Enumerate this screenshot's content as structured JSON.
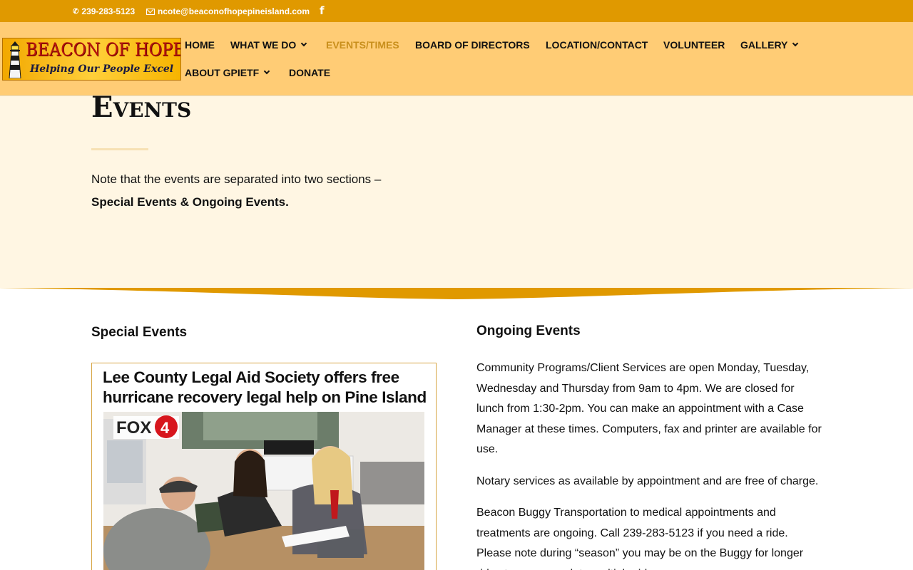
{
  "topbar": {
    "phone": "239-283-5123",
    "email": "ncote@beaconofhopepineisland.com",
    "facebook_icon": "facebook-icon"
  },
  "logo": {
    "line1": "BEACON OF HOPE",
    "line2": "Helping Our People Excel"
  },
  "nav": {
    "items": [
      {
        "label": "HOME"
      },
      {
        "label": "WHAT WE DO"
      },
      {
        "label": "EVENTS/TIMES"
      },
      {
        "label": "BOARD OF DIRECTORS"
      },
      {
        "label": "LOCATION/CONTACT"
      },
      {
        "label": "VOLUNTEER"
      },
      {
        "label": "GALLERY"
      },
      {
        "label": "ABOUT GPIETF"
      },
      {
        "label": "DONATE"
      }
    ]
  },
  "hero": {
    "title": "Events",
    "intro_line1": "Note that the events are separated into two sections –",
    "intro_line2": "Special Events & Ongoing Events."
  },
  "special": {
    "heading": "Special Events",
    "flyer_headline": "Lee County Legal Aid Society offers free hurricane recovery legal help on Pine Island",
    "flyer_logo": "FOX4"
  },
  "ongoing": {
    "heading": "Ongoing Events",
    "paragraphs": [
      "Community Programs/Client Services are open Monday, Tuesday, Wednesday and Thursday from 9am to 4pm. We are closed for lunch from 1:30-2pm. You can make an appointment with a Case Manager at these times. Computers, fax and printer are available for use.",
      "Notary services as available by appointment and are free of charge.",
      "Beacon Buggy Transportation to medical appointments and treatments are ongoing. Call 239-283-5123 if you need a ride. Please note during “season” you may be on the Buggy for longer rides to accommodate multiple rides."
    ]
  },
  "colors": {
    "topbar": "#e09900",
    "header": "#ffcc75",
    "hero": "#fff6e3",
    "active_nav": "#c98f1c"
  }
}
